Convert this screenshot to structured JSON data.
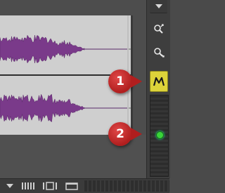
{
  "right_panel": {
    "dropdown_icon": "triangle-down-icon",
    "zoom_in_icon": "zoom-in-icon",
    "zoom_out_icon": "zoom-out-icon",
    "auto_mode_icon": "mountain-m-icon",
    "highlight_color": "#ddd33a",
    "indicator_color": "#39d43a"
  },
  "callouts": [
    {
      "label": "1"
    },
    {
      "label": "2"
    }
  ],
  "waveform": {
    "color": "#7a3a8a",
    "background": "#cfcfcf"
  },
  "bottom_bar": {
    "items": [
      "triangle-down-icon",
      "waveform-overview-icon",
      "split-view-icon",
      "window-icon"
    ]
  }
}
